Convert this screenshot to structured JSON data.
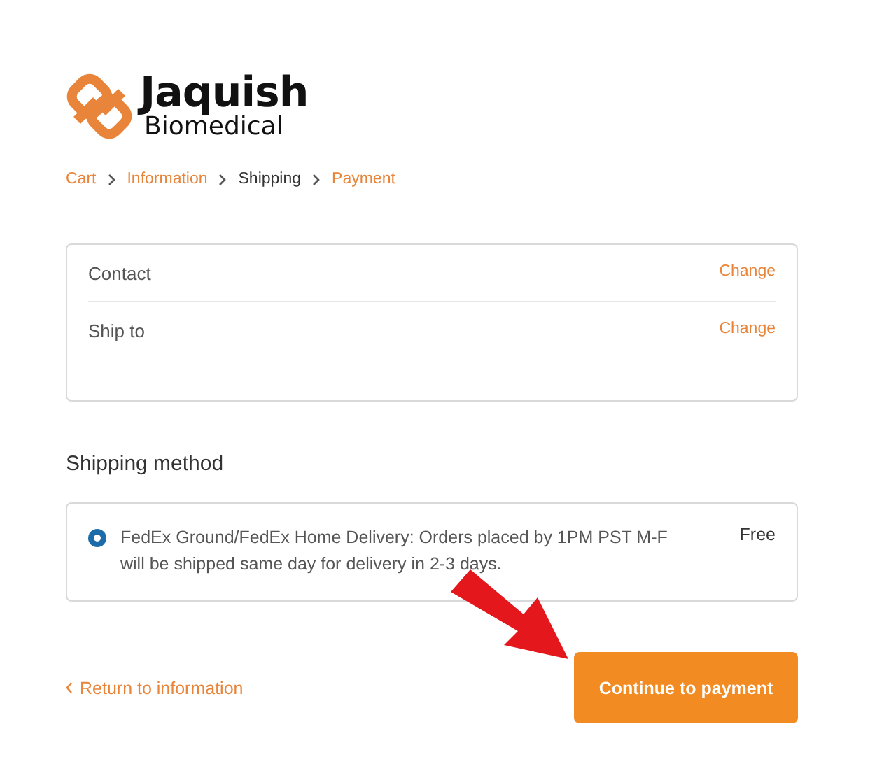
{
  "brand": {
    "name": "Jaquish",
    "tagline": "Biomedical"
  },
  "breadcrumb": [
    {
      "label": "Cart",
      "selected": false
    },
    {
      "label": "Information",
      "selected": false
    },
    {
      "label": "Shipping",
      "selected": true
    },
    {
      "label": "Payment",
      "selected": false
    }
  ],
  "review": [
    {
      "label": "Contact",
      "action": "Change"
    },
    {
      "label": "Ship to",
      "action": "Change"
    }
  ],
  "shipping": {
    "heading": "Shipping method",
    "methods": [
      {
        "label": "FedEx Ground/FedEx Home Delivery: Orders placed by 1PM PST M-F will be shipped same day for delivery in 2-3 days.",
        "price": "Free",
        "selected": true
      }
    ]
  },
  "footer": {
    "back": "Return to information",
    "continue": "Continue to payment"
  }
}
